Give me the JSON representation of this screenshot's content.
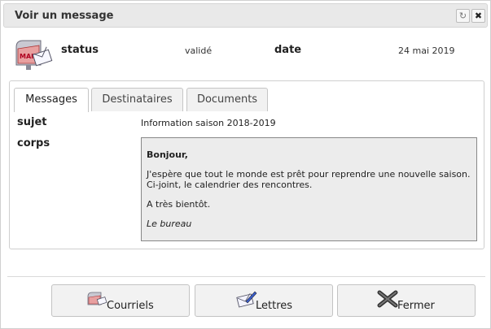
{
  "dialog": {
    "title": "Voir un message",
    "refresh_icon": "↻",
    "close_icon": "✖"
  },
  "header": {
    "status_label": "status",
    "status_value": "validé",
    "date_label": "date",
    "date_value": "24 mai 2019",
    "mail_icon_text": "MAIL"
  },
  "tabs": [
    {
      "label": "Messages",
      "active": true
    },
    {
      "label": "Destinataires",
      "active": false
    },
    {
      "label": "Documents",
      "active": false
    }
  ],
  "message": {
    "subject_label": "sujet",
    "subject_value": "Information saison 2018-2019",
    "body_label": "corps",
    "body": {
      "greeting": "Bonjour,",
      "line1": "J'espère que tout le monde est prêt pour reprendre une nouvelle saison.",
      "line2": "Ci-joint, le calendrier des rencontres.",
      "closing": "A très bientôt.",
      "signature": "Le bureau"
    }
  },
  "buttons": {
    "courriels": "Courriels",
    "lettres": "Lettres",
    "fermer": "Fermer"
  }
}
